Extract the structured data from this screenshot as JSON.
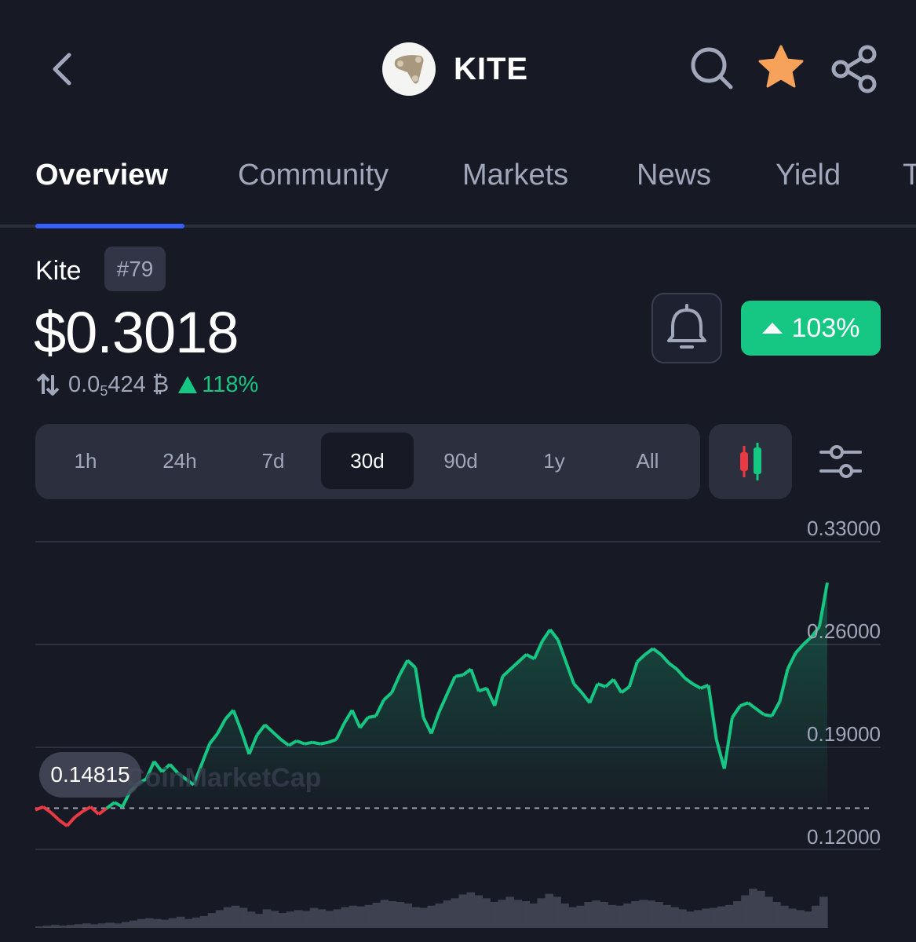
{
  "header": {
    "title": "KITE",
    "icons": [
      "chevron-left-icon",
      "search-icon",
      "star-icon",
      "share-icon"
    ],
    "favorite_color": "#f7a25a"
  },
  "tabs": [
    {
      "label": "Overview",
      "active": true
    },
    {
      "label": "Community",
      "active": false
    },
    {
      "label": "Markets",
      "active": false
    },
    {
      "label": "News",
      "active": false
    },
    {
      "label": "Yield",
      "active": false
    },
    {
      "label": "T",
      "active": false
    }
  ],
  "coin": {
    "name": "Kite",
    "rank": "#79",
    "price": "$0.3018",
    "btc_price_prefix": "0.0",
    "btc_price_subscript": "5",
    "btc_price_suffix": "424 ₿",
    "btc_change": "118%",
    "change_badge": "103%"
  },
  "periods": [
    {
      "label": "1h",
      "active": false
    },
    {
      "label": "24h",
      "active": false
    },
    {
      "label": "7d",
      "active": false
    },
    {
      "label": "30d",
      "active": true
    },
    {
      "label": "90d",
      "active": false
    },
    {
      "label": "1y",
      "active": false
    },
    {
      "label": "All",
      "active": false
    }
  ],
  "colors": {
    "accent": "#3861fb",
    "up": "#16c784",
    "down": "#ea3943",
    "background": "#171924"
  },
  "chart_data": {
    "type": "line",
    "y_ticks": [
      "0.33000",
      "0.26000",
      "0.19000",
      "0.12000"
    ],
    "ylim": [
      0.12,
      0.33
    ],
    "baseline": 0.14815,
    "baseline_label": "0.14815",
    "watermark": "CoinMarketCap",
    "x": [
      0,
      1,
      2,
      3,
      4,
      5,
      6,
      7,
      8,
      9,
      10,
      11,
      12,
      13,
      14,
      15,
      16,
      17,
      18,
      19,
      20,
      21,
      22,
      23,
      24,
      25,
      26,
      27,
      28,
      29,
      30,
      31,
      32,
      33,
      34,
      35,
      36,
      37,
      38,
      39,
      40,
      41,
      42,
      43,
      44,
      45,
      46,
      47,
      48,
      49,
      50,
      51,
      52,
      53,
      54,
      55,
      56,
      57,
      58,
      59,
      60,
      61,
      62,
      63,
      64,
      65,
      66,
      67,
      68,
      69,
      70,
      71,
      72,
      73,
      74,
      75,
      76,
      77,
      78,
      79,
      80,
      81,
      82,
      83,
      84,
      85,
      86,
      87,
      88,
      89,
      90,
      91,
      92,
      93,
      94,
      95,
      96,
      97,
      98,
      99,
      100
    ],
    "values": [
      0.147,
      0.149,
      0.145,
      0.14,
      0.136,
      0.142,
      0.146,
      0.149,
      0.144,
      0.148,
      0.152,
      0.149,
      0.16,
      0.165,
      0.168,
      0.18,
      0.173,
      0.178,
      0.172,
      0.168,
      0.164,
      0.178,
      0.192,
      0.199,
      0.209,
      0.215,
      0.201,
      0.185,
      0.198,
      0.205,
      0.2,
      0.195,
      0.191,
      0.194,
      0.192,
      0.193,
      0.192,
      0.193,
      0.195,
      0.206,
      0.215,
      0.203,
      0.21,
      0.211,
      0.222,
      0.227,
      0.239,
      0.249,
      0.244,
      0.21,
      0.199,
      0.214,
      0.226,
      0.238,
      0.239,
      0.243,
      0.228,
      0.23,
      0.218,
      0.238,
      0.243,
      0.248,
      0.253,
      0.25,
      0.262,
      0.27,
      0.263,
      0.248,
      0.233,
      0.227,
      0.22,
      0.233,
      0.231,
      0.236,
      0.227,
      0.231,
      0.248,
      0.253,
      0.257,
      0.253,
      0.247,
      0.243,
      0.237,
      0.233,
      0.23,
      0.232,
      0.195,
      0.175,
      0.21,
      0.218,
      0.22,
      0.216,
      0.212,
      0.211,
      0.221,
      0.243,
      0.254,
      0.26,
      0.265,
      0.272,
      0.302
    ],
    "volume": [
      2,
      3,
      4,
      3,
      4,
      5,
      6,
      5,
      6,
      7,
      6,
      8,
      10,
      12,
      13,
      12,
      11,
      13,
      15,
      12,
      14,
      16,
      20,
      24,
      28,
      30,
      27,
      22,
      19,
      25,
      23,
      20,
      22,
      24,
      23,
      27,
      25,
      23,
      25,
      28,
      30,
      29,
      31,
      34,
      38,
      36,
      35,
      33,
      28,
      27,
      30,
      33,
      37,
      40,
      45,
      48,
      44,
      40,
      35,
      38,
      42,
      38,
      36,
      33,
      40,
      46,
      42,
      33,
      28,
      30,
      35,
      37,
      35,
      31,
      30,
      33,
      36,
      38,
      37,
      35,
      31,
      28,
      25,
      22,
      24,
      26,
      27,
      29,
      31,
      36,
      44,
      53,
      50,
      42,
      35,
      30,
      26,
      24,
      22,
      30,
      42
    ]
  }
}
